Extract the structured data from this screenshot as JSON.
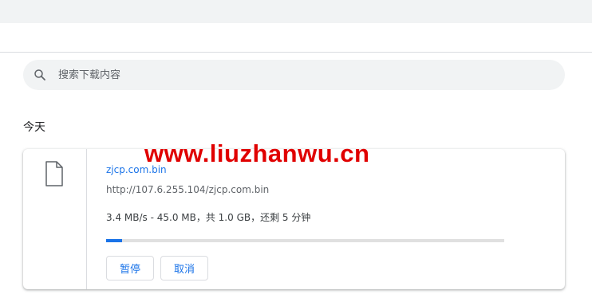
{
  "search": {
    "placeholder": "搜索下载内容",
    "icon": "search-icon"
  },
  "section": {
    "title": "今天"
  },
  "download": {
    "file_name": "zjcp.com.bin",
    "url": "http://107.6.255.104/zjcp.com.bin",
    "status": "3.4 MB/s - 45.0 MB，共 1.0 GB，还剩 5 分钟",
    "progress_fraction": 0.04,
    "icon": "file-icon",
    "pause_label": "暂停",
    "cancel_label": "取消"
  },
  "watermark": {
    "text": "www.liuzhanwu.cn"
  },
  "colors": {
    "accent": "#1a73e8",
    "watermark": "#e00000",
    "toolbar_bg": "#f1f3f4"
  }
}
